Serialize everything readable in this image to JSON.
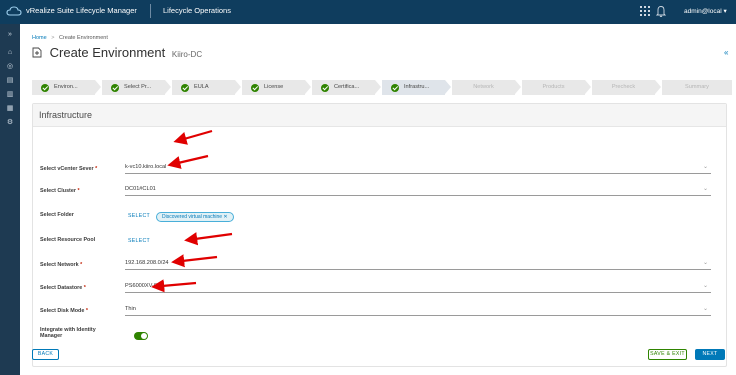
{
  "topbar": {
    "app_title": "vRealize Suite Lifecycle Manager",
    "section": "Lifecycle Operations",
    "user": "admin@local ▾"
  },
  "leftnav": {
    "items": [
      "»",
      "⌂",
      "◎",
      "▤",
      "▥",
      "▦",
      "⚙"
    ]
  },
  "breadcrumb": {
    "home": "Home",
    "sep": ">",
    "current": "Create Environment"
  },
  "page": {
    "title": "Create Environment",
    "subtitle": "Kiiro-DC",
    "collapse": "«"
  },
  "steps": [
    {
      "label": "Environ..."
    },
    {
      "label": "Select Pr..."
    },
    {
      "label": "EULA"
    },
    {
      "label": "License"
    },
    {
      "label": "Certifica..."
    },
    {
      "label": "Infrastru..."
    },
    {
      "label": "Network"
    },
    {
      "label": "Products"
    },
    {
      "label": "Precheck"
    },
    {
      "label": "Summary"
    }
  ],
  "card": {
    "title": "Infrastructure",
    "vcenter_label": "Select vCenter Sever",
    "vcenter_value": "k-vc10.kiiro.local",
    "cluster_label": "Select Cluster",
    "cluster_value": "DC01#CL01",
    "folder_label": "Select Folder",
    "folder_link": "SELECT",
    "folder_chip": "Discovered virtual machine  ✕",
    "pool_label": "Select Resource Pool",
    "pool_link": "SELECT",
    "network_label": "Select Network",
    "network_value": "192.168.208.0/24",
    "datastore_label": "Select Datastore",
    "datastore_value": "PS6000XV-01",
    "diskmode_label": "Select Disk Mode",
    "diskmode_value": "Thin",
    "identity_label_1": "Integrate with Identity",
    "identity_label_2": "Manager",
    "identity_enabled": true,
    "required_mark": "*",
    "chevron": "⌄"
  },
  "footer": {
    "back": "BACK",
    "save_exit": "SAVE & EXIT",
    "next": "NEXT"
  },
  "colors": {
    "topbar": "#0f3d5e",
    "accent": "#0079b8",
    "success": "#2f8400",
    "annotation_arrow": "#e00000"
  }
}
